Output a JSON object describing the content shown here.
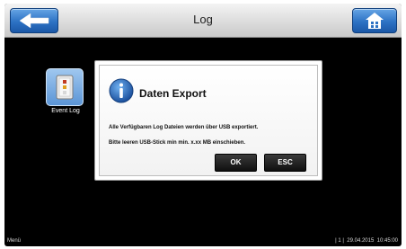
{
  "header": {
    "title": "Log"
  },
  "apps": [
    {
      "label": "Event Log"
    }
  ],
  "dialog": {
    "title": "Daten Export",
    "line1": "Alle Verfügbaren Log Dateien werden über USB exportiert.",
    "line2": "Bitte leeren USB-Stick min min. x.xx MB einschieben.",
    "ok_label": "OK",
    "esc_label": "ESC"
  },
  "footer": {
    "menu_label": "Menü",
    "status": "| 1 |  29.04.2015  10:45:00"
  },
  "icons": {
    "back": "back-arrow-icon",
    "home": "home-icon",
    "event_log": "event-log-icon",
    "info": "info-icon"
  },
  "colors": {
    "accent_blue": "#2d72c4",
    "screen_background": "#000000",
    "header_background": "#dcdcdc"
  }
}
